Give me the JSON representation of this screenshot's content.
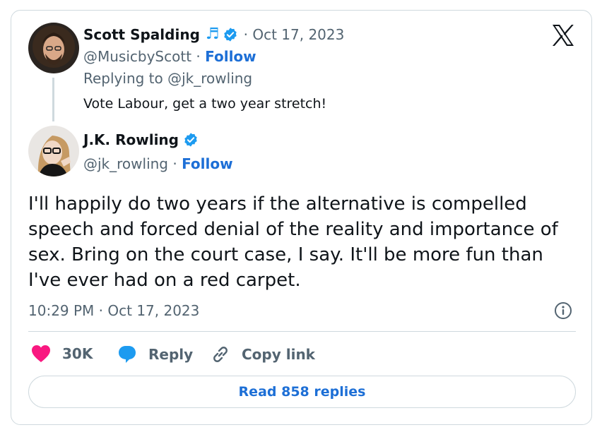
{
  "reply_tweet": {
    "name": "Scott Spalding",
    "music_note": "♬",
    "date": "· Oct 17, 2023",
    "handle": "@MusicbyScott",
    "sep": "·",
    "follow_label": "Follow",
    "replying_prefix": "Replying to",
    "replying_to": "@jk_rowling",
    "text": "Vote Labour, get a two year stretch!"
  },
  "main_tweet": {
    "name": "J.K. Rowling",
    "handle": "@jk_rowling",
    "sep": "·",
    "follow_label": "Follow",
    "text_lines": [
      "I'll happily do two years if the alternative is compelled",
      "speech and forced denial of the reality and importance of",
      "sex. Bring on the court case, I say. It'll be more fun than",
      "I've ever had on a red carpet."
    ],
    "timestamp": "10:29 PM · Oct 17, 2023"
  },
  "actions": {
    "like_count": "30K",
    "reply_label": "Reply",
    "copy_label": "Copy link"
  },
  "read_replies_label": "Read 858 replies",
  "colors": {
    "accent": "#1d6fd6",
    "like": "#f91880",
    "muted": "#536471",
    "border": "#cfd9de",
    "verified": "#1d9bf0"
  },
  "icons": {
    "logo": "x-logo-icon",
    "verified": "verified-badge-icon",
    "like": "heart-icon",
    "reply": "speech-bubble-icon",
    "copy": "link-icon",
    "info": "info-icon"
  }
}
